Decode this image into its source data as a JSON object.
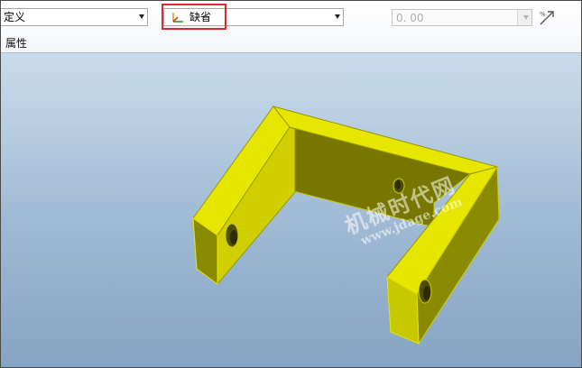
{
  "toolbar": {
    "left_combo_value": "定义",
    "coordinate_combo_value": "缺省",
    "value_combo_value": "0. 00",
    "properties_label": "属性"
  },
  "icons": {
    "coordinate": "coordinate-system-icon",
    "scale": "scale-tool-icon"
  },
  "colors": {
    "highlight": "#e0262e",
    "part_yellow": "#e6e600",
    "part_dark": "#7a7a00"
  },
  "watermark": {
    "title": "机械时代网",
    "url": "www.jdage.com"
  }
}
